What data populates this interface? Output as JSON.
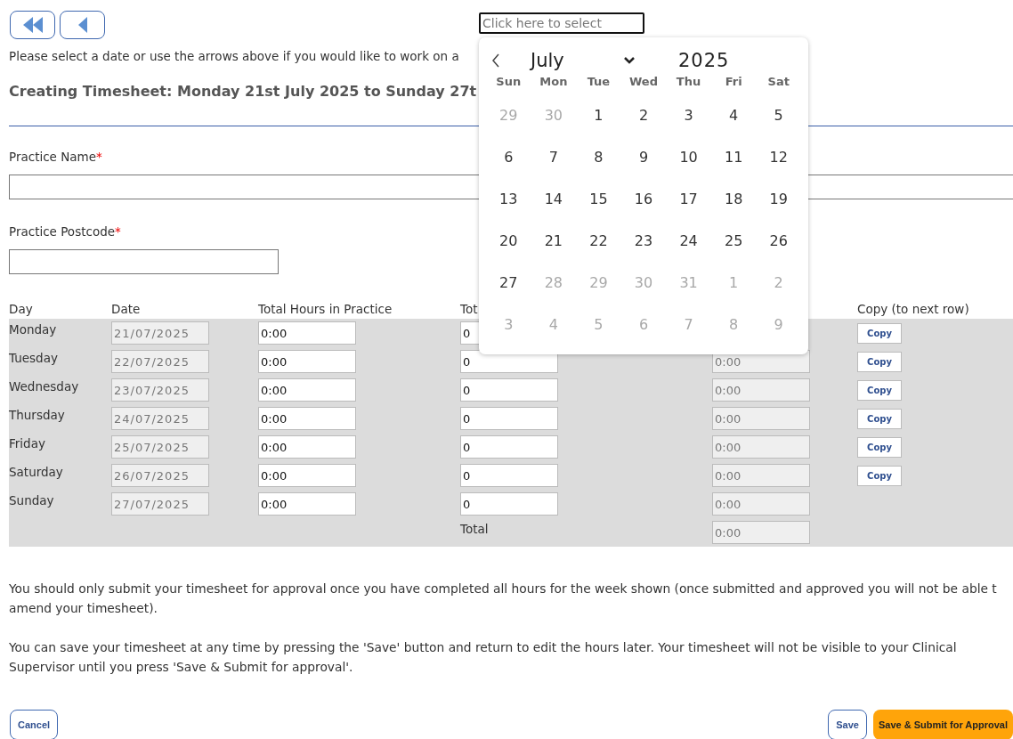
{
  "nav_buttons": [
    {
      "kind": "first"
    },
    {
      "kind": "previous"
    }
  ],
  "date_picker": {
    "placeholder": "Click here to select",
    "calendar": {
      "month": "July",
      "year": "2025",
      "weekdays": [
        "Sun",
        "Mon",
        "Tue",
        "Wed",
        "Thu",
        "Fri",
        "Sat"
      ],
      "weeks": [
        [
          {
            "day": "29",
            "disabled": true
          },
          {
            "day": "30",
            "disabled": true
          },
          {
            "day": "1",
            "disabled": false
          },
          {
            "day": "2",
            "disabled": false
          },
          {
            "day": "3",
            "disabled": false
          },
          {
            "day": "4",
            "disabled": false
          },
          {
            "day": "5",
            "disabled": false
          }
        ],
        [
          {
            "day": "6",
            "disabled": false
          },
          {
            "day": "7",
            "disabled": false
          },
          {
            "day": "8",
            "disabled": false
          },
          {
            "day": "9",
            "disabled": false
          },
          {
            "day": "10",
            "disabled": false
          },
          {
            "day": "11",
            "disabled": false
          },
          {
            "day": "12",
            "disabled": false
          }
        ],
        [
          {
            "day": "13",
            "disabled": false
          },
          {
            "day": "14",
            "disabled": false
          },
          {
            "day": "15",
            "disabled": false
          },
          {
            "day": "16",
            "disabled": false
          },
          {
            "day": "17",
            "disabled": false
          },
          {
            "day": "18",
            "disabled": false
          },
          {
            "day": "19",
            "disabled": false
          }
        ],
        [
          {
            "day": "20",
            "disabled": false
          },
          {
            "day": "21",
            "disabled": false
          },
          {
            "day": "22",
            "disabled": false
          },
          {
            "day": "23",
            "disabled": false
          },
          {
            "day": "24",
            "disabled": false
          },
          {
            "day": "25",
            "disabled": false
          },
          {
            "day": "26",
            "disabled": false
          }
        ],
        [
          {
            "day": "27",
            "disabled": false
          },
          {
            "day": "28",
            "disabled": true
          },
          {
            "day": "29",
            "disabled": true
          },
          {
            "day": "30",
            "disabled": true
          },
          {
            "day": "31",
            "disabled": true
          },
          {
            "day": "1",
            "disabled": true
          },
          {
            "day": "2",
            "disabled": true
          }
        ],
        [
          {
            "day": "3",
            "disabled": true
          },
          {
            "day": "4",
            "disabled": true
          },
          {
            "day": "5",
            "disabled": true
          },
          {
            "day": "6",
            "disabled": true
          },
          {
            "day": "7",
            "disabled": true
          },
          {
            "day": "8",
            "disabled": true
          },
          {
            "day": "9",
            "disabled": true
          }
        ]
      ]
    }
  },
  "instruction": "Please select a date or use the arrows above if you would like to work on a",
  "heading": "Creating Timesheet: Monday 21st July 2025 to Sunday 27t",
  "fields": [
    {
      "label": "Practice Name",
      "required_mark": "*",
      "kind": "wide"
    },
    {
      "label": "Practice Postcode",
      "required_mark": "*",
      "kind": "narrow"
    }
  ],
  "table": {
    "columns": {
      "day": "Day",
      "date": "Date",
      "hours": "Total Hours in Practice",
      "column_4": "Tot",
      "copy": "Copy (to next row)"
    },
    "rows": [
      {
        "day": "Monday",
        "date": "21/07/2025",
        "hours": "0:00",
        "column_4": "0",
        "copy": "Copy"
      },
      {
        "day": "Tuesday",
        "date": "22/07/2025",
        "hours": "0:00",
        "column_4": "0",
        "column_5": "0:00",
        "copy": "Copy"
      },
      {
        "day": "Wednesday",
        "date": "23/07/2025",
        "hours": "0:00",
        "column_4": "0",
        "column_5": "0:00",
        "copy": "Copy"
      },
      {
        "day": "Thursday",
        "date": "24/07/2025",
        "hours": "0:00",
        "column_4": "0",
        "column_5": "0:00",
        "copy": "Copy"
      },
      {
        "day": "Friday",
        "date": "25/07/2025",
        "hours": "0:00",
        "column_4": "0",
        "column_5": "0:00",
        "copy": "Copy"
      },
      {
        "day": "Saturday",
        "date": "26/07/2025",
        "hours": "0:00",
        "column_4": "0",
        "column_5": "0:00",
        "copy": "Copy"
      },
      {
        "day": "Sunday",
        "date": "27/07/2025",
        "hours": "0:00",
        "column_4": "0",
        "column_5": "0:00"
      }
    ],
    "total": {
      "label": "Total",
      "value": "0:00"
    }
  },
  "notes": [
    "You should only submit your timesheet for approval once you have completed all hours for the week shown (once submitted and approved you will not be able t amend your timesheet).",
    "You can save your timesheet at any time by pressing the 'Save' button and return to edit the hours later. Your timesheet will not be visible to your Clinical Supervisor until you press 'Save & Submit for approval'."
  ],
  "buttons": [
    {
      "label": "Cancel",
      "kind": "cancel"
    },
    {
      "label": "Save",
      "kind": "save"
    },
    {
      "label": "Save & Submit for Approval",
      "kind": "submit"
    }
  ]
}
